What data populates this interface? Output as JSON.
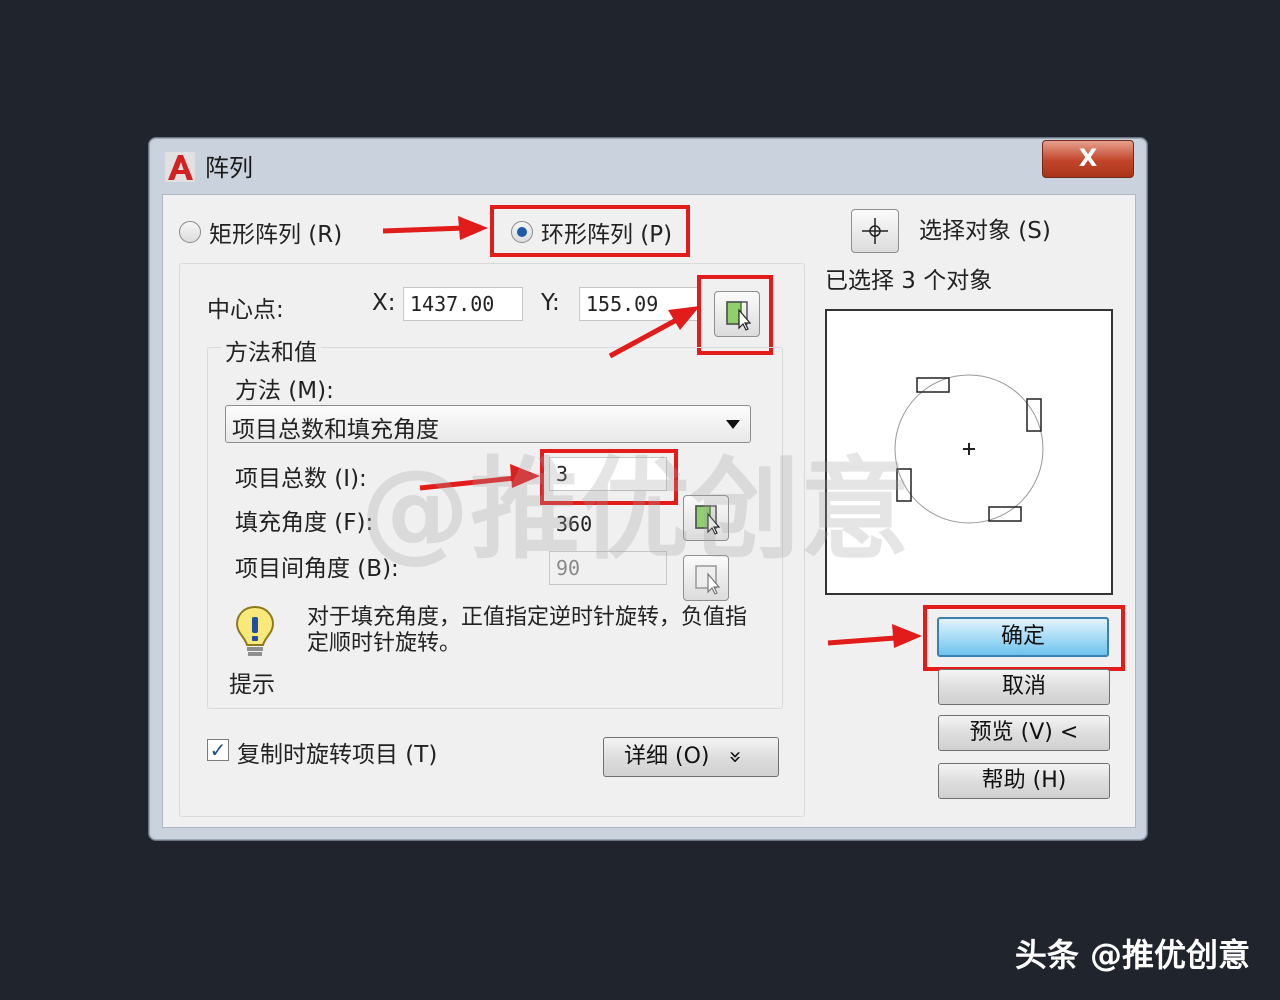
{
  "window": {
    "title": "阵列",
    "close_label": "X"
  },
  "array_type": {
    "rect_label": "矩形阵列 (R)",
    "polar_label": "环形阵列 (P)",
    "selected": "polar"
  },
  "center": {
    "label": "中心点:",
    "x_label": "X:",
    "x_value": "1437.00",
    "y_label": "Y:",
    "y_value": "155.09"
  },
  "method_group": {
    "title": "方法和值",
    "method_label": "方法 (M):",
    "method_value": "项目总数和填充角度",
    "total_label": "项目总数 (I):",
    "total_value": "3",
    "fill_label": "填充角度 (F):",
    "fill_value": "360",
    "between_label": "项目间角度 (B):",
    "between_value": "90"
  },
  "tip": {
    "text": "对于填充角度，正值指定逆时针旋转，负值指定顺时针旋转。",
    "caption": "提示"
  },
  "rotate": {
    "label": "复制时旋转项目 (T)",
    "checked": "✓"
  },
  "details_button": "详细 (O)",
  "details_chevron": "»",
  "select_objects": {
    "label": "选择对象 (S)",
    "status": "已选择 3 个对象"
  },
  "buttons": {
    "ok": "确定",
    "cancel": "取消",
    "preview": "预览 (V) <",
    "help": "帮助 (H)"
  },
  "watermark": "@推优创意",
  "footer_brand": "头条 @推优创意",
  "colors": {
    "annotation_red": "#e21b1b",
    "accent_blue": "#1f5aa8"
  }
}
